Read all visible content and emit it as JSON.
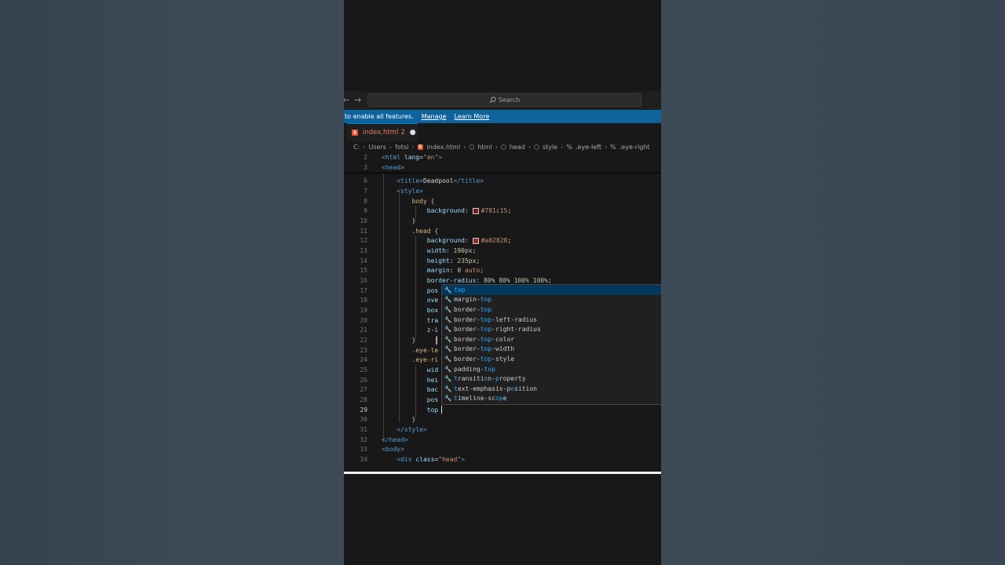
{
  "titlebar": {
    "back_arrow": "←",
    "forward_arrow": "→",
    "search_placeholder": "Search"
  },
  "notification": {
    "text": "to enable all features.",
    "manage_label": "Manage",
    "learn_more_label": "Learn More"
  },
  "tab": {
    "icon": "html5-icon",
    "filename": "index.html",
    "problems": "2",
    "modified_dot": "●"
  },
  "breadcrumb": [
    "C:",
    "Users",
    "fotsi",
    "index.html",
    "html",
    "head",
    "style",
    ".eye-left",
    ".eye-right"
  ],
  "editor": {
    "line_numbers": [
      "2",
      "3",
      "6",
      "7",
      "8",
      "9",
      "10",
      "11",
      "12",
      "13",
      "14",
      "15",
      "16",
      "17",
      "18",
      "19",
      "20",
      "21",
      "22",
      "23",
      "24",
      "25",
      "26",
      "27",
      "28",
      "29",
      "30",
      "31",
      "32",
      "33",
      "34"
    ],
    "active_line": "29",
    "colors": {
      "body_bg": "#781c15",
      "head_bg": "#a02820"
    }
  },
  "suggestions": {
    "query": "top",
    "items": [
      "top",
      "margin-top",
      "border-top",
      "border-top-left-radius",
      "border-top-right-radius",
      "border-top-color",
      "border-top-width",
      "border-top-style",
      "padding-top",
      "transition-property",
      "text-emphasis-position",
      "timeline-scope"
    ]
  }
}
